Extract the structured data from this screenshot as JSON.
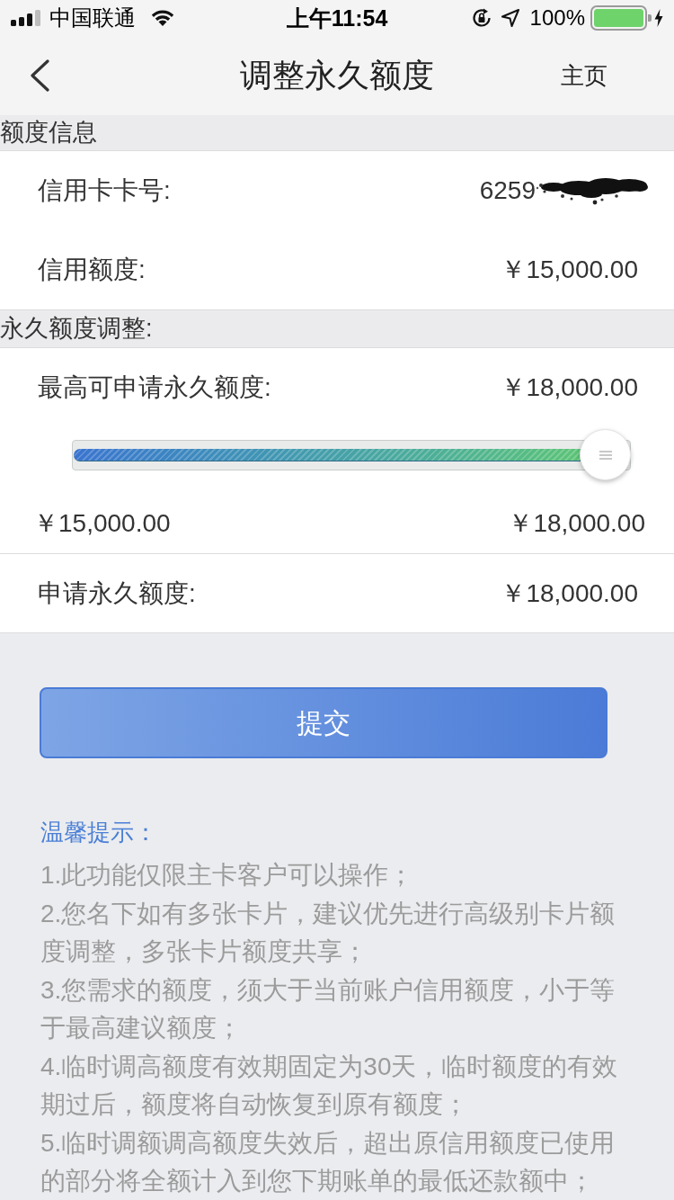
{
  "status_bar": {
    "carrier": "中国联通",
    "time": "上午11:54",
    "battery": "100%"
  },
  "nav_bar": {
    "title": "调整永久额度",
    "home_link": "主页"
  },
  "credit_info": {
    "header": "额度信息",
    "rows": [
      {
        "kind": "masked",
        "label": "信用卡卡号:",
        "value": "6259"
      },
      {
        "kind": "plain",
        "label": "信用额度:",
        "value": "￥15,000.00"
      }
    ]
  },
  "adjustment": {
    "header": "永久额度调整:",
    "max_row": {
      "label": "最高可申请永久额度:",
      "value": "￥18,000.00"
    },
    "slider": {
      "level": 1,
      "min_label": "￥15,000.00",
      "max_label": "￥18,000.00"
    },
    "request_row": {
      "label": "申请永久额度:",
      "value": "￥18,000.00"
    }
  },
  "submit_button": "提交",
  "tips": {
    "title": "温馨提示：",
    "items": [
      "1.此功能仅限主卡客户可以操作；",
      "2.您名下如有多张卡片，建议优先进行高级别卡片额度调整，多张卡片额度共享；",
      "3.您需求的额度，须大于当前账户信用额度，小于等于最高建议额度；",
      "4.临时调高额度有效期固定为30天，临时额度的有效期过后，额度将自动恢复到原有额度；",
      "5.临时调额调高额度失效后，超出原信用额度已使用的部分将全额计入到您下期账单的最低还款额中；"
    ]
  }
}
